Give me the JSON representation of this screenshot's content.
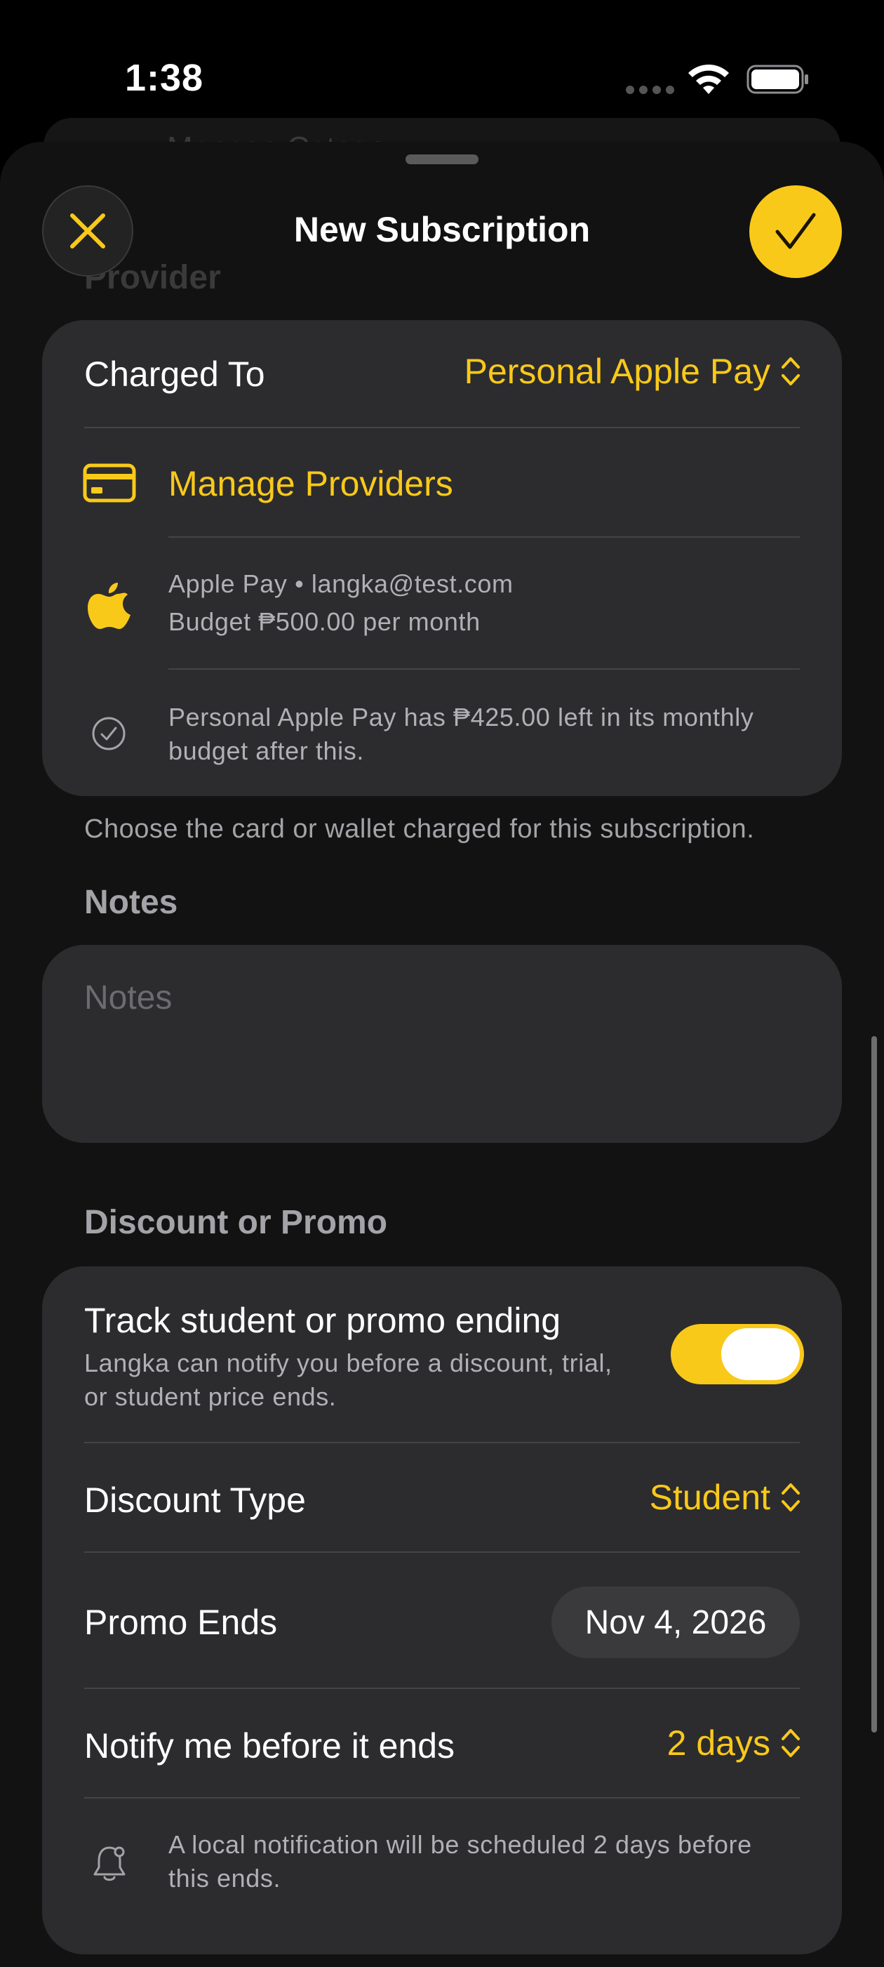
{
  "status_bar": {
    "time": "1:38"
  },
  "background": {
    "ghost_row_text": "Manage Catego...",
    "ghost_section": "Provider"
  },
  "nav": {
    "title": "New Subscription"
  },
  "provider": {
    "charged_to_label": "Charged To",
    "charged_to_value": "Personal Apple Pay",
    "manage_label": "Manage Providers",
    "account_line": "Apple Pay • langka@test.com",
    "budget_line": "Budget ₱500.00 per month",
    "remaining_line1": "Personal Apple Pay has ₱425.00 left in its monthly",
    "remaining_line2": "budget after this.",
    "footer": "Choose the card or wallet charged for this subscription."
  },
  "notes": {
    "header": "Notes",
    "placeholder": "Notes"
  },
  "discount": {
    "header": "Discount or Promo",
    "track_title": "Track student or promo ending",
    "track_desc1": "Langka can notify you before a discount, trial,",
    "track_desc2": "or student price ends.",
    "track_enabled": true,
    "type_label": "Discount Type",
    "type_value": "Student",
    "ends_label": "Promo Ends",
    "ends_value": "Nov 4, 2026",
    "notify_label": "Notify me before it ends",
    "notify_value": "2 days",
    "notice_line1": "A local notification will be scheduled 2 days before",
    "notice_line2": "this ends."
  },
  "colors": {
    "accent": "#f9c91a",
    "card": "#2c2c2e",
    "background": "#000000"
  }
}
